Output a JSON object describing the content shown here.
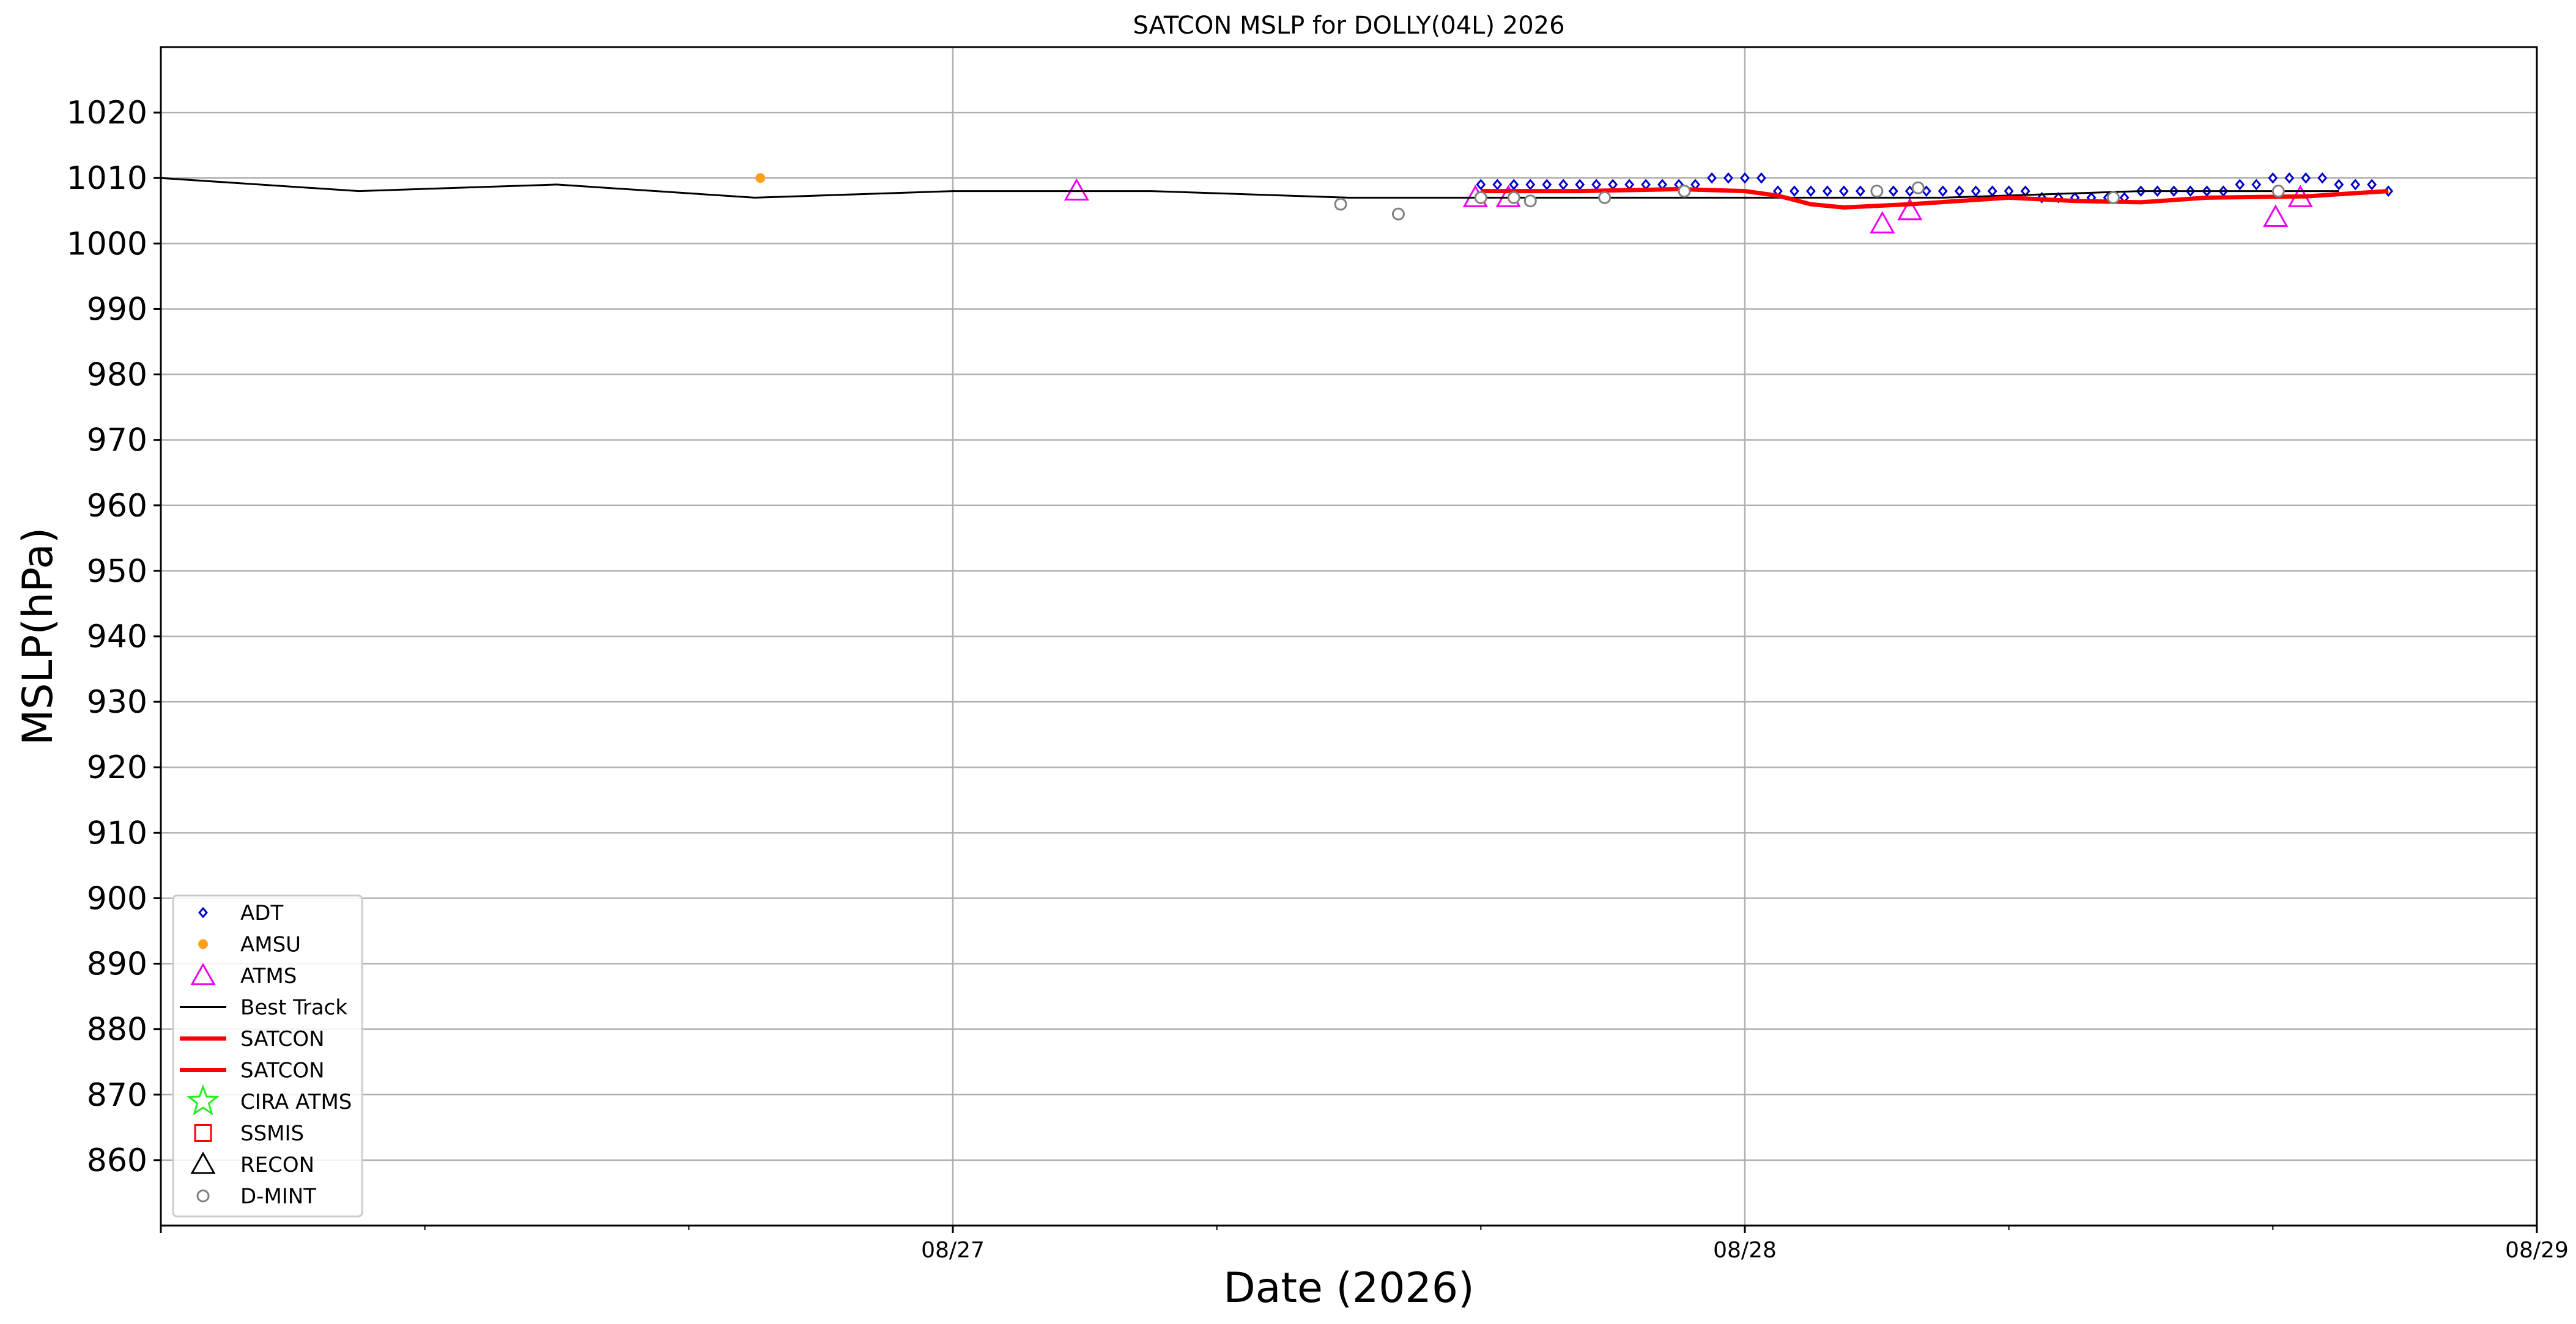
{
  "chart_data": {
    "type": "scatter",
    "title": "SATCON MSLP for DOLLY(04L) 2026",
    "xlabel": "Date (2026)",
    "ylabel": "MSLP(hPa)",
    "xlim": [
      "2026-08-26T00:00",
      "2026-08-29T00:00"
    ],
    "ylim": [
      850,
      1030
    ],
    "yticks": [
      860,
      870,
      880,
      890,
      900,
      910,
      920,
      930,
      940,
      950,
      960,
      970,
      980,
      990,
      1000,
      1010,
      1020
    ],
    "xticks": [
      {
        "t": "2026-08-27T00:00",
        "label": "08/27"
      },
      {
        "t": "2026-08-28T00:00",
        "label": "08/28"
      },
      {
        "t": "2026-08-29T00:00",
        "label": "08/29"
      }
    ],
    "grid": true,
    "legend_position": "lower-left",
    "series": [
      {
        "name": "ADT",
        "marker": "diamond",
        "color": "#0000cc",
        "points": [
          [
            "2026-08-27T16:00",
            1009
          ],
          [
            "2026-08-27T16:30",
            1009
          ],
          [
            "2026-08-27T17:00",
            1009
          ],
          [
            "2026-08-27T17:30",
            1009
          ],
          [
            "2026-08-27T18:00",
            1009
          ],
          [
            "2026-08-27T18:30",
            1009
          ],
          [
            "2026-08-27T19:00",
            1009
          ],
          [
            "2026-08-27T19:30",
            1009
          ],
          [
            "2026-08-27T20:00",
            1009
          ],
          [
            "2026-08-27T20:30",
            1009
          ],
          [
            "2026-08-27T21:00",
            1009
          ],
          [
            "2026-08-27T21:30",
            1009
          ],
          [
            "2026-08-27T22:00",
            1009
          ],
          [
            "2026-08-27T22:30",
            1009
          ],
          [
            "2026-08-27T23:00",
            1010
          ],
          [
            "2026-08-27T23:30",
            1010
          ],
          [
            "2026-08-28T00:00",
            1010
          ],
          [
            "2026-08-28T00:30",
            1010
          ],
          [
            "2026-08-28T01:00",
            1008
          ],
          [
            "2026-08-28T01:30",
            1008
          ],
          [
            "2026-08-28T02:00",
            1008
          ],
          [
            "2026-08-28T02:30",
            1008
          ],
          [
            "2026-08-28T03:00",
            1008
          ],
          [
            "2026-08-28T03:30",
            1008
          ],
          [
            "2026-08-28T04:00",
            1008
          ],
          [
            "2026-08-28T04:30",
            1008
          ],
          [
            "2026-08-28T05:00",
            1008
          ],
          [
            "2026-08-28T05:30",
            1008
          ],
          [
            "2026-08-28T06:00",
            1008
          ],
          [
            "2026-08-28T06:30",
            1008
          ],
          [
            "2026-08-28T07:00",
            1008
          ],
          [
            "2026-08-28T07:30",
            1008
          ],
          [
            "2026-08-28T08:00",
            1008
          ],
          [
            "2026-08-28T08:30",
            1008
          ],
          [
            "2026-08-28T09:00",
            1007
          ],
          [
            "2026-08-28T09:30",
            1007
          ],
          [
            "2026-08-28T10:00",
            1007
          ],
          [
            "2026-08-28T10:30",
            1007
          ],
          [
            "2026-08-28T11:00",
            1007
          ],
          [
            "2026-08-28T11:30",
            1007
          ],
          [
            "2026-08-28T12:00",
            1008
          ],
          [
            "2026-08-28T12:30",
            1008
          ],
          [
            "2026-08-28T13:00",
            1008
          ],
          [
            "2026-08-28T13:30",
            1008
          ],
          [
            "2026-08-28T14:00",
            1008
          ],
          [
            "2026-08-28T14:30",
            1008
          ],
          [
            "2026-08-28T15:00",
            1009
          ],
          [
            "2026-08-28T15:30",
            1009
          ],
          [
            "2026-08-28T16:00",
            1010
          ],
          [
            "2026-08-28T16:30",
            1010
          ],
          [
            "2026-08-28T17:00",
            1010
          ],
          [
            "2026-08-28T17:30",
            1010
          ],
          [
            "2026-08-28T18:00",
            1009
          ],
          [
            "2026-08-28T18:30",
            1009
          ],
          [
            "2026-08-28T19:00",
            1009
          ],
          [
            "2026-08-28T19:30",
            1008
          ]
        ]
      },
      {
        "name": "AMSU",
        "marker": "dot",
        "color": "#ff9f1c",
        "points": [
          [
            "2026-08-26T18:10",
            1010
          ]
        ]
      },
      {
        "name": "ATMS",
        "marker": "triangle",
        "color": "#ee00ee",
        "points": [
          [
            "2026-08-27T03:45",
            1008
          ],
          [
            "2026-08-27T15:50",
            1007
          ],
          [
            "2026-08-27T16:50",
            1007
          ],
          [
            "2026-08-28T04:10",
            1003
          ],
          [
            "2026-08-28T05:00",
            1005
          ],
          [
            "2026-08-28T16:05",
            1004
          ],
          [
            "2026-08-28T16:50",
            1007
          ]
        ]
      },
      {
        "name": "Best Track",
        "marker": "line",
        "color": "#000000",
        "points": [
          [
            "2026-08-26T00:00",
            1010
          ],
          [
            "2026-08-26T06:00",
            1008
          ],
          [
            "2026-08-26T12:00",
            1009
          ],
          [
            "2026-08-26T18:00",
            1007
          ],
          [
            "2026-08-27T00:00",
            1008
          ],
          [
            "2026-08-27T06:00",
            1008
          ],
          [
            "2026-08-27T12:00",
            1007
          ],
          [
            "2026-08-27T18:00",
            1007
          ],
          [
            "2026-08-28T00:00",
            1007
          ],
          [
            "2026-08-28T06:00",
            1007
          ],
          [
            "2026-08-28T12:00",
            1008
          ],
          [
            "2026-08-28T18:00",
            1008
          ]
        ]
      },
      {
        "name": "SATCON",
        "marker": "line",
        "color": "#ff0000",
        "points": [
          [
            "2026-08-27T16:00",
            1008
          ],
          [
            "2026-08-27T19:00",
            1008
          ],
          [
            "2026-08-27T22:00",
            1008.3
          ],
          [
            "2026-08-28T00:00",
            1008
          ],
          [
            "2026-08-28T01:00",
            1007.3
          ],
          [
            "2026-08-28T02:00",
            1006
          ],
          [
            "2026-08-28T03:00",
            1005.5
          ],
          [
            "2026-08-28T05:00",
            1006
          ],
          [
            "2026-08-28T08:00",
            1007
          ],
          [
            "2026-08-28T10:00",
            1006.5
          ],
          [
            "2026-08-28T12:00",
            1006.3
          ],
          [
            "2026-08-28T14:00",
            1007
          ],
          [
            "2026-08-28T17:00",
            1007.2
          ],
          [
            "2026-08-28T19:30",
            1008
          ]
        ]
      },
      {
        "name": "SATCON",
        "marker": "line",
        "color": "#ff0000",
        "points": []
      },
      {
        "name": "CIRA ATMS",
        "marker": "star",
        "color": "#22ee22",
        "points": []
      },
      {
        "name": "SSMIS",
        "marker": "square",
        "color": "#ff0000",
        "points": []
      },
      {
        "name": "RECON",
        "marker": "triangle",
        "color": "#000000",
        "points": []
      },
      {
        "name": "D-MINT",
        "marker": "circle",
        "color": "#808080",
        "points": [
          [
            "2026-08-27T11:45",
            1006
          ],
          [
            "2026-08-27T13:30",
            1004.5
          ],
          [
            "2026-08-27T16:00",
            1007
          ],
          [
            "2026-08-27T17:00",
            1007
          ],
          [
            "2026-08-27T17:30",
            1006.5
          ],
          [
            "2026-08-27T19:45",
            1007
          ],
          [
            "2026-08-27T22:10",
            1008
          ],
          [
            "2026-08-28T05:15",
            1008.5
          ],
          [
            "2026-08-28T04:00",
            1008
          ],
          [
            "2026-08-28T11:10",
            1007
          ],
          [
            "2026-08-28T16:10",
            1008
          ]
        ]
      }
    ]
  }
}
